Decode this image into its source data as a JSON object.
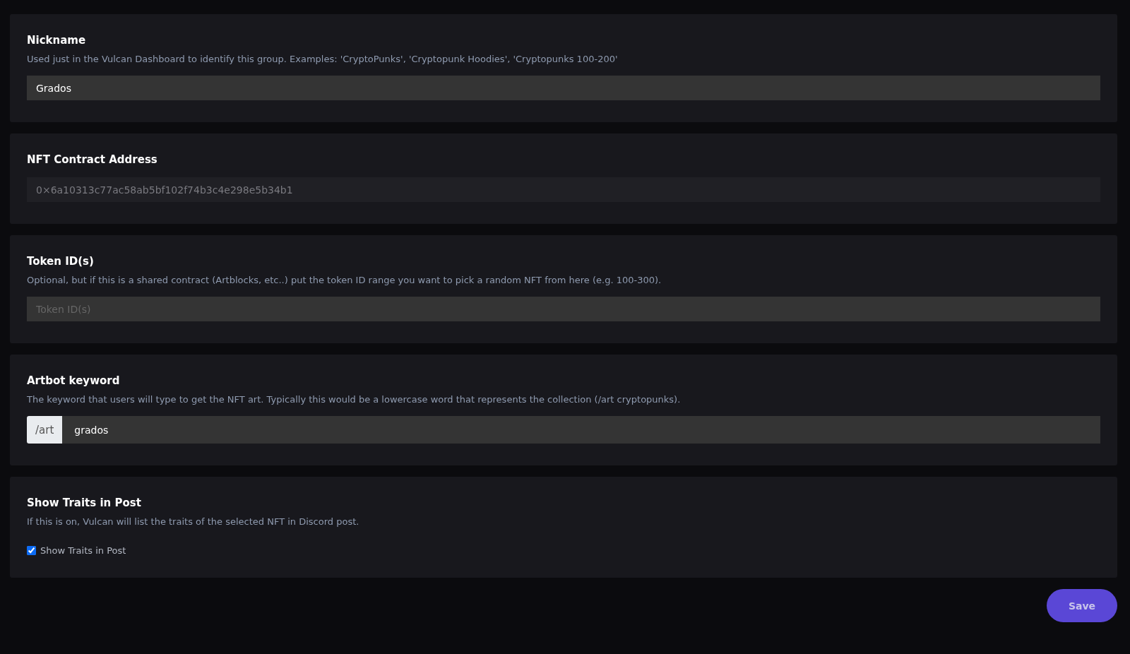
{
  "sections": [
    {
      "kind": "text",
      "title": "Nickname",
      "description": "Used just in the Vulcan Dashboard to identify this group. Examples: 'CryptoPunks', 'Cryptopunk Hoodies', 'Cryptopunks 100-200'",
      "field": {
        "value": "Grados",
        "disabled": false
      }
    },
    {
      "kind": "text",
      "title": "NFT Contract Address",
      "field": {
        "value": "0×6a10313c77ac58ab5bf102f74b3c4e298e5b34b1",
        "disabled": true
      }
    },
    {
      "kind": "text",
      "title": "Token ID(s)",
      "description": "Optional, but if this is a shared contract (Artblocks, etc..) put the token ID range you want to pick a random NFT from here (e.g. 100-300).",
      "field": {
        "placeholder": "Token ID(s)",
        "disabled": false
      }
    },
    {
      "kind": "prefixed",
      "title": "Artbot keyword",
      "description": "The keyword that users will type to get the NFT art. Typically this would be a lowercase word that represents the collection (/art cryptopunks).",
      "field": {
        "prefix": "/art",
        "value": "grados",
        "disabled": false
      }
    },
    {
      "kind": "checkbox",
      "title": "Show Traits in Post",
      "description": "If this is on, Vulcan will list the traits of the selected NFT in Discord post.",
      "checkbox": {
        "label": "Show Traits in Post",
        "checked": true
      }
    }
  ],
  "save_button": "Save"
}
